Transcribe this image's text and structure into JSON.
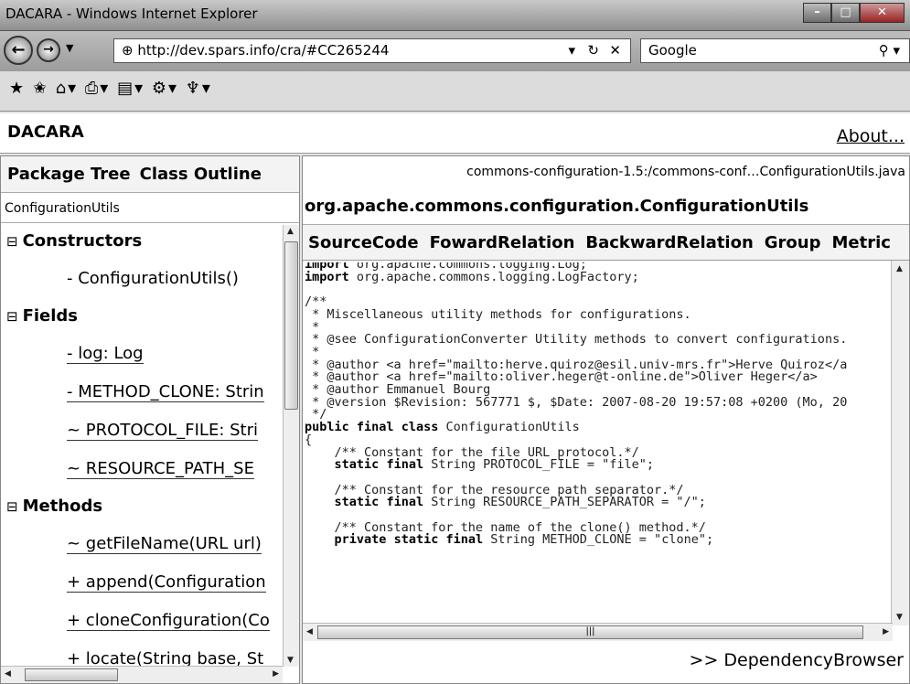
{
  "window": {
    "title": "DACARA - Windows Internet Explorer",
    "url": "http://dev.spars.info/cra/#CC265244",
    "search_placeholder": "Google",
    "toolbar_icons": [
      "favorites-star-icon",
      "add-favorites-icon",
      "home-icon",
      "print-icon",
      "page-icon",
      "tools-icon",
      "research-icon"
    ]
  },
  "header": {
    "title": "DACARA",
    "about": "About..."
  },
  "left": {
    "tabs": [
      "Package Tree",
      "Class Outline"
    ],
    "class_name": "ConfigurationUtils",
    "constructors": {
      "label": "Constructors",
      "items": [
        "- ConfigurationUtils()"
      ]
    },
    "fields": {
      "label": "Fields",
      "items": [
        "- log: Log",
        "- METHOD_CLONE: Strin",
        "~ PROTOCOL_FILE: Stri",
        "~ RESOURCE_PATH_SE"
      ]
    },
    "methods": {
      "label": "Methods",
      "items": [
        "~ getFileName(URL url)",
        "+ append(Configuration",
        "+ cloneConfiguration(Co",
        "+ locate(String base, St"
      ]
    }
  },
  "right": {
    "file_path": "commons-configuration-1.5:/commons-conf…ConfigurationUtils.java",
    "fq_name": "org.apache.commons.configuration.ConfigurationUtils",
    "tabs": [
      "SourceCode",
      "FowardRelation",
      "BackwardRelation",
      "Group",
      "Metric"
    ],
    "dependency_link": ">> DependencyBrowser",
    "code_lines": [
      "import org.apache.commons.logging.Log;",
      "import org.apache.commons.logging.LogFactory;",
      "",
      "/**",
      " * Miscellaneous utility methods for configurations.",
      " *",
      " * @see ConfigurationConverter Utility methods to convert configurations.",
      " *",
      " * @author <a href=\"mailto:herve.quiroz@esil.univ-mrs.fr\">Herve Quiroz</a",
      " * @author <a href=\"mailto:oliver.heger@t-online.de\">Oliver Heger</a>",
      " * @author Emmanuel Bourg",
      " * @version $Revision: 567771 $, $Date: 2007-08-20 19:57:08 +0200 (Mo, 20",
      " */",
      "public final class ConfigurationUtils",
      "{",
      "    /** Constant for the file URL protocol.*/",
      "    static final String PROTOCOL_FILE = \"file\";",
      "",
      "    /** Constant for the resource path separator.*/",
      "    static final String RESOURCE_PATH_SEPARATOR = \"/\";",
      "",
      "    /** Constant for the name of the clone() method.*/",
      "    private static final String METHOD_CLONE = \"clone\";"
    ]
  }
}
